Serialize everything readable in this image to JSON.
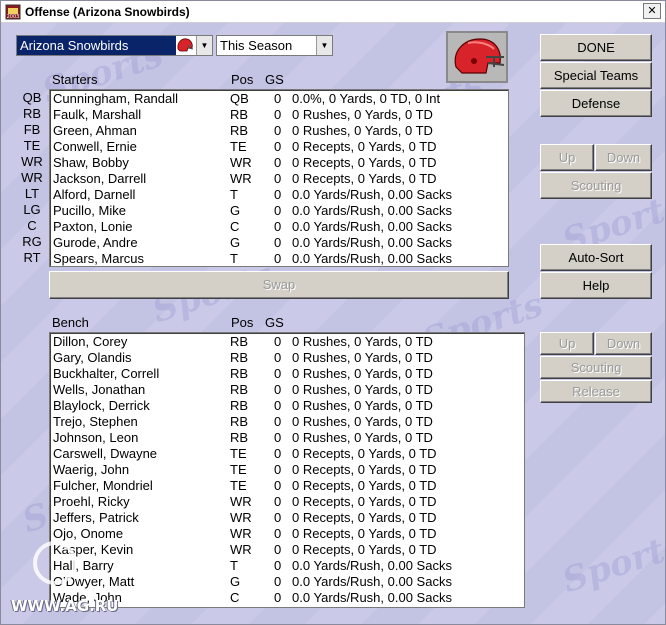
{
  "window": {
    "title": "Offense (Arizona Snowbirds)",
    "close": "✕"
  },
  "team_select": {
    "value": "Arizona Snowbirds"
  },
  "period_select": {
    "value": "This Season"
  },
  "buttons": {
    "done": "DONE",
    "special_teams": "Special Teams",
    "defense": "Defense",
    "up": "Up",
    "down": "Down",
    "scouting": "Scouting",
    "auto_sort": "Auto-Sort",
    "help": "Help",
    "swap": "Swap",
    "release": "Release"
  },
  "starters": {
    "header": {
      "name": "Starters",
      "pos": "Pos",
      "gs": "GS"
    },
    "rows": [
      {
        "slot": "QB",
        "name": "Cunningham, Randall",
        "pos": "QB",
        "gs": "0",
        "stats": "0.0%, 0 Yards, 0 TD, 0 Int"
      },
      {
        "slot": "RB",
        "name": "Faulk, Marshall",
        "pos": "RB",
        "gs": "0",
        "stats": "0 Rushes, 0 Yards, 0 TD"
      },
      {
        "slot": "FB",
        "name": "Green, Ahman",
        "pos": "RB",
        "gs": "0",
        "stats": "0 Rushes, 0 Yards, 0 TD"
      },
      {
        "slot": "TE",
        "name": "Conwell, Ernie",
        "pos": "TE",
        "gs": "0",
        "stats": "0 Recepts, 0 Yards, 0 TD"
      },
      {
        "slot": "WR",
        "name": "Shaw, Bobby",
        "pos": "WR",
        "gs": "0",
        "stats": "0 Recepts, 0 Yards, 0 TD"
      },
      {
        "slot": "WR",
        "name": "Jackson, Darrell",
        "pos": "WR",
        "gs": "0",
        "stats": "0 Recepts, 0 Yards, 0 TD"
      },
      {
        "slot": "LT",
        "name": "Alford, Darnell",
        "pos": "T",
        "gs": "0",
        "stats": "0.0 Yards/Rush, 0.00 Sacks"
      },
      {
        "slot": "LG",
        "name": "Pucillo, Mike",
        "pos": "G",
        "gs": "0",
        "stats": "0.0 Yards/Rush, 0.00 Sacks"
      },
      {
        "slot": "C",
        "name": "Paxton, Lonie",
        "pos": "C",
        "gs": "0",
        "stats": "0.0 Yards/Rush, 0.00 Sacks"
      },
      {
        "slot": "RG",
        "name": "Gurode, Andre",
        "pos": "G",
        "gs": "0",
        "stats": "0.0 Yards/Rush, 0.00 Sacks"
      },
      {
        "slot": "RT",
        "name": "Spears, Marcus",
        "pos": "T",
        "gs": "0",
        "stats": "0.0 Yards/Rush, 0.00 Sacks"
      }
    ]
  },
  "bench": {
    "header": {
      "name": "Bench",
      "pos": "Pos",
      "gs": "GS"
    },
    "rows": [
      {
        "name": "Dillon, Corey",
        "pos": "RB",
        "gs": "0",
        "stats": "0 Rushes, 0 Yards, 0 TD"
      },
      {
        "name": "Gary, Olandis",
        "pos": "RB",
        "gs": "0",
        "stats": "0 Rushes, 0 Yards, 0 TD"
      },
      {
        "name": "Buckhalter, Correll",
        "pos": "RB",
        "gs": "0",
        "stats": "0 Rushes, 0 Yards, 0 TD"
      },
      {
        "name": "Wells, Jonathan",
        "pos": "RB",
        "gs": "0",
        "stats": "0 Rushes, 0 Yards, 0 TD"
      },
      {
        "name": "Blaylock, Derrick",
        "pos": "RB",
        "gs": "0",
        "stats": "0 Rushes, 0 Yards, 0 TD"
      },
      {
        "name": "Trejo, Stephen",
        "pos": "RB",
        "gs": "0",
        "stats": "0 Rushes, 0 Yards, 0 TD"
      },
      {
        "name": "Johnson, Leon",
        "pos": "RB",
        "gs": "0",
        "stats": "0 Rushes, 0 Yards, 0 TD"
      },
      {
        "name": "Carswell, Dwayne",
        "pos": "TE",
        "gs": "0",
        "stats": "0 Recepts, 0 Yards, 0 TD"
      },
      {
        "name": "Waerig, John",
        "pos": "TE",
        "gs": "0",
        "stats": "0 Recepts, 0 Yards, 0 TD"
      },
      {
        "name": "Fulcher, Mondriel",
        "pos": "TE",
        "gs": "0",
        "stats": "0 Recepts, 0 Yards, 0 TD"
      },
      {
        "name": "Proehl, Ricky",
        "pos": "WR",
        "gs": "0",
        "stats": "0 Recepts, 0 Yards, 0 TD"
      },
      {
        "name": "Jeffers, Patrick",
        "pos": "WR",
        "gs": "0",
        "stats": "0 Recepts, 0 Yards, 0 TD"
      },
      {
        "name": "Ojo, Onome",
        "pos": "WR",
        "gs": "0",
        "stats": "0 Recepts, 0 Yards, 0 TD"
      },
      {
        "name": "Kasper, Kevin",
        "pos": "WR",
        "gs": "0",
        "stats": "0 Recepts, 0 Yards, 0 TD"
      },
      {
        "name": "Hall, Barry",
        "pos": "T",
        "gs": "0",
        "stats": "0.0 Yards/Rush, 0.00 Sacks"
      },
      {
        "name": "O'Dwyer, Matt",
        "pos": "G",
        "gs": "0",
        "stats": "0.0 Yards/Rush, 0.00 Sacks"
      },
      {
        "name": "Wade, John",
        "pos": "C",
        "gs": "0",
        "stats": "0.0 Yards/Rush, 0.00 Sacks"
      }
    ]
  },
  "watermark": "WWW.AG.RU",
  "colors": {
    "selection": "#0a246a",
    "helmet": "#d8232a",
    "background": "#c9c9e6"
  }
}
